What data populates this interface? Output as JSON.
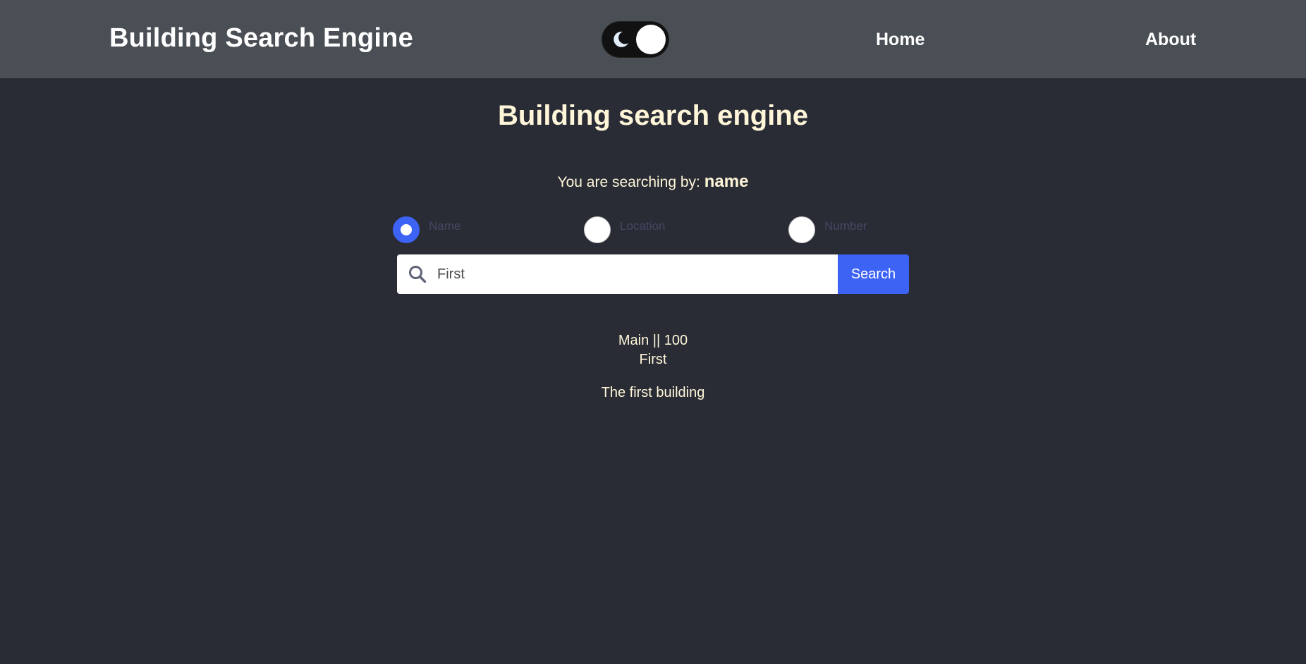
{
  "navbar": {
    "brand": "Building Search Engine",
    "theme_toggle": {
      "icon": "moon-icon",
      "state": "dark"
    },
    "links": [
      {
        "label": "Home"
      },
      {
        "label": "About"
      }
    ]
  },
  "main": {
    "title": "Building search engine",
    "searching_by_prefix": "You are searching by:",
    "searching_by_value": "name",
    "search_options": [
      {
        "label": "Name",
        "checked": true
      },
      {
        "label": "Location",
        "checked": false
      },
      {
        "label": "Number",
        "checked": false
      }
    ],
    "search": {
      "value": "First",
      "button_label": "Search",
      "icon": "search-icon"
    },
    "results": [
      {
        "header": "Main || 100",
        "name": "First",
        "description": "The first building"
      }
    ]
  },
  "colors": {
    "navbar_bg": "#4a4f55",
    "page_bg": "#292c35",
    "accent": "#3d63f5",
    "text_cream": "#fff6d9"
  }
}
